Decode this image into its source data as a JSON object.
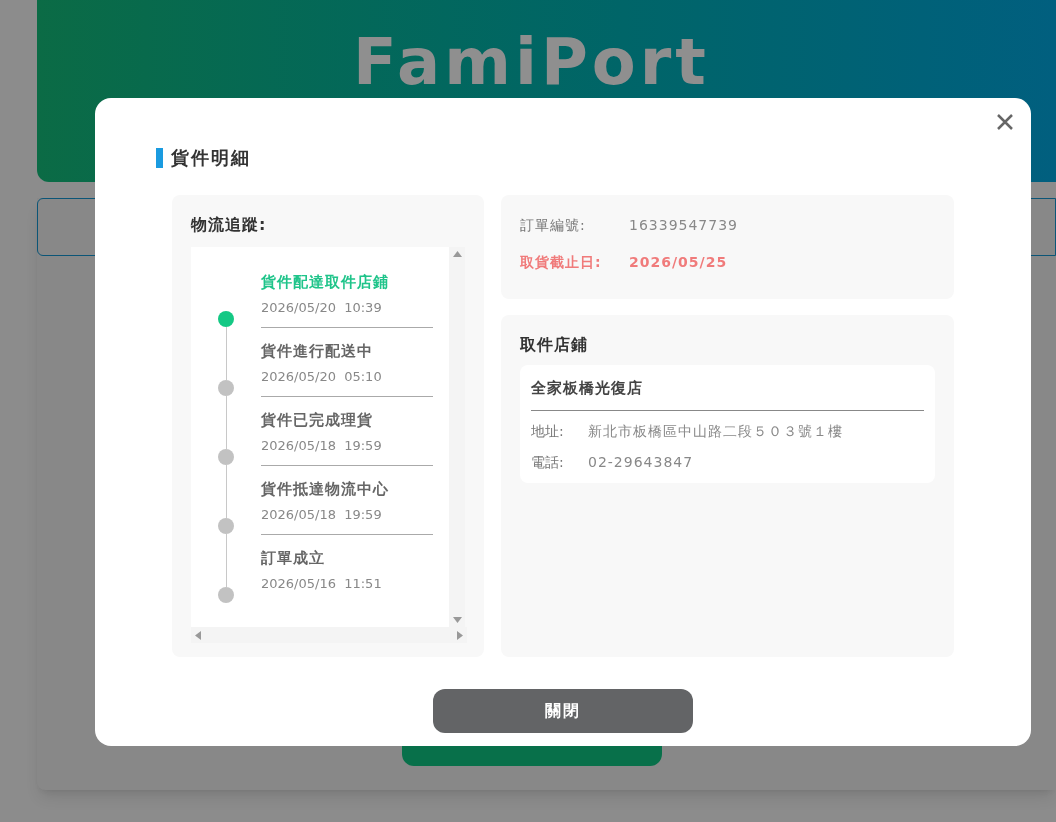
{
  "header": {
    "logo": "FamiPort"
  },
  "dialog": {
    "title": "貨件明細",
    "tracking": {
      "heading": "物流追蹤:",
      "steps": [
        {
          "label": "貨件配達取件店鋪",
          "time": "2026/05/20  10:39",
          "current": true
        },
        {
          "label": "貨件進行配送中",
          "time": "2026/05/20  05:10",
          "current": false
        },
        {
          "label": "貨件已完成理貨",
          "time": "2026/05/18  19:59",
          "current": false
        },
        {
          "label": "貨件抵達物流中心",
          "time": "2026/05/18  19:59",
          "current": false
        },
        {
          "label": "訂單成立",
          "time": "2026/05/16  11:51",
          "current": false
        }
      ]
    },
    "order": {
      "number_label": "訂單編號:",
      "number": "16339547739",
      "deadline_label": "取貨截止日:",
      "deadline": "2026/05/25"
    },
    "store": {
      "heading": "取件店鋪",
      "name": "全家板橋光復店",
      "address_label": "地址:",
      "address": "新北市板橋區中山路二段５０３號１樓",
      "phone_label": "電話:",
      "phone": "02-29643847"
    },
    "close_button": "關閉"
  }
}
